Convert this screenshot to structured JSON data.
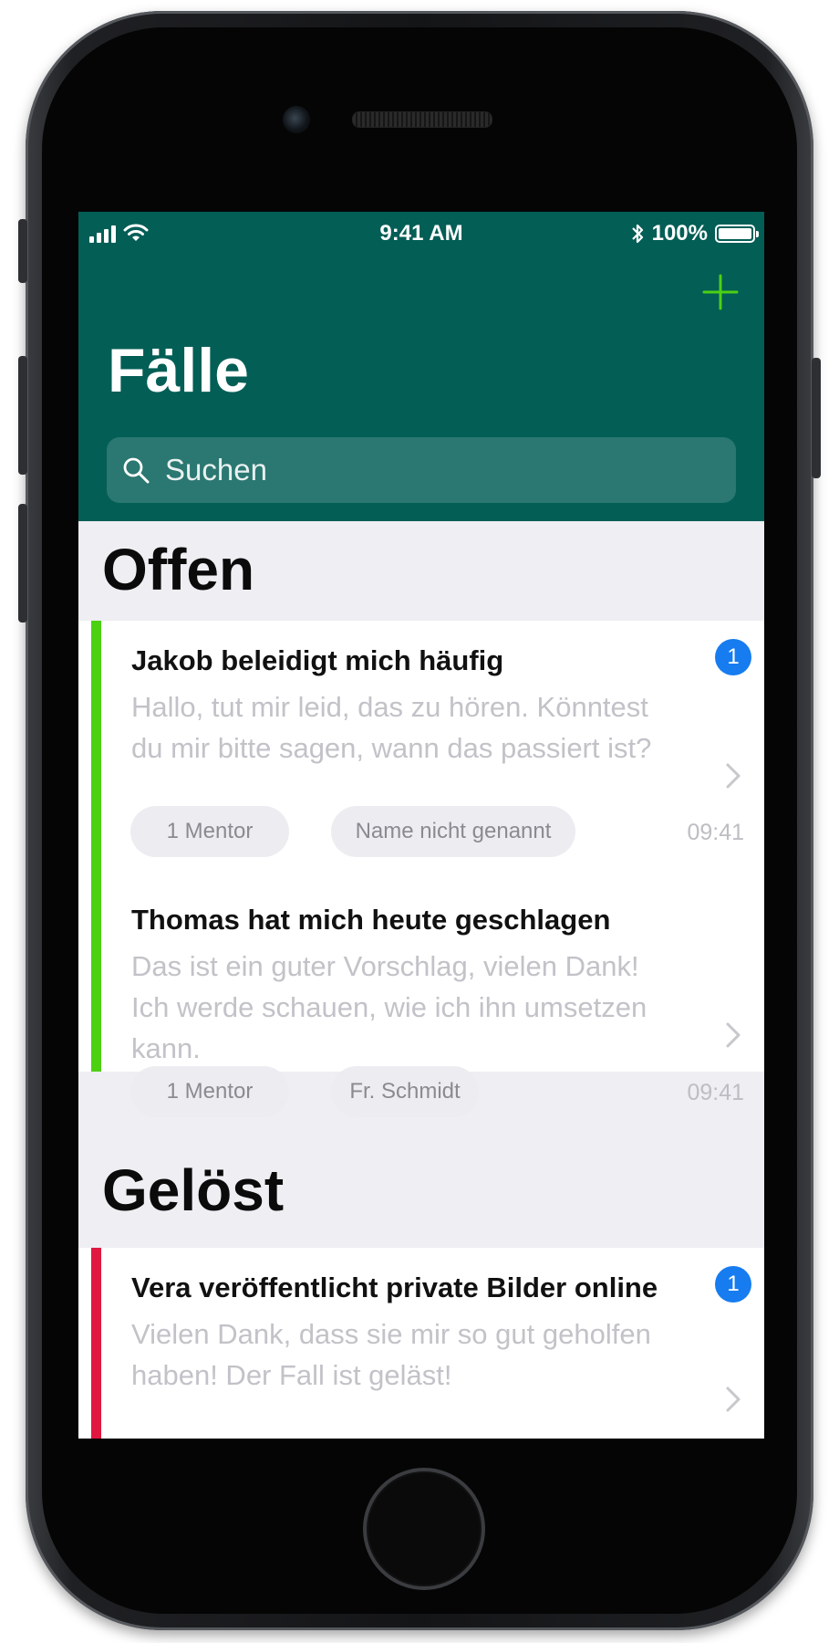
{
  "status_bar": {
    "time": "9:41 AM",
    "battery": "100%"
  },
  "header": {
    "title": "Fälle",
    "add_icon": "plus-icon",
    "accent_color": "#035e56"
  },
  "search": {
    "placeholder": "Suchen"
  },
  "sections": [
    {
      "title": "Offen",
      "accent_color": "#4cd012",
      "cases": [
        {
          "title": "Jakob beleidigt mich häufig",
          "message": "Hallo, tut mir leid, das zu hören. Könntest du mir bitte sagen, wann das passiert ist?",
          "badge": "1",
          "tags": [
            "1 Mentor",
            "Name nicht genannt"
          ],
          "time": "09:41"
        },
        {
          "title": "Thomas hat mich heute geschlagen",
          "message": "Das ist ein guter Vorschlag, vielen Dank! Ich werde schauen, wie ich ihn umsetzen kann.",
          "tags": [
            "1 Mentor",
            "Fr. Schmidt"
          ],
          "time": "09:41"
        }
      ]
    },
    {
      "title": "Gelöst",
      "accent_color": "#e0183f",
      "cases": [
        {
          "title": "Vera veröffentlicht private Bilder online",
          "message": "Vielen Dank, dass sie mir so gut geholfen haben! Der Fall ist geläst!",
          "badge": "1"
        }
      ]
    }
  ]
}
